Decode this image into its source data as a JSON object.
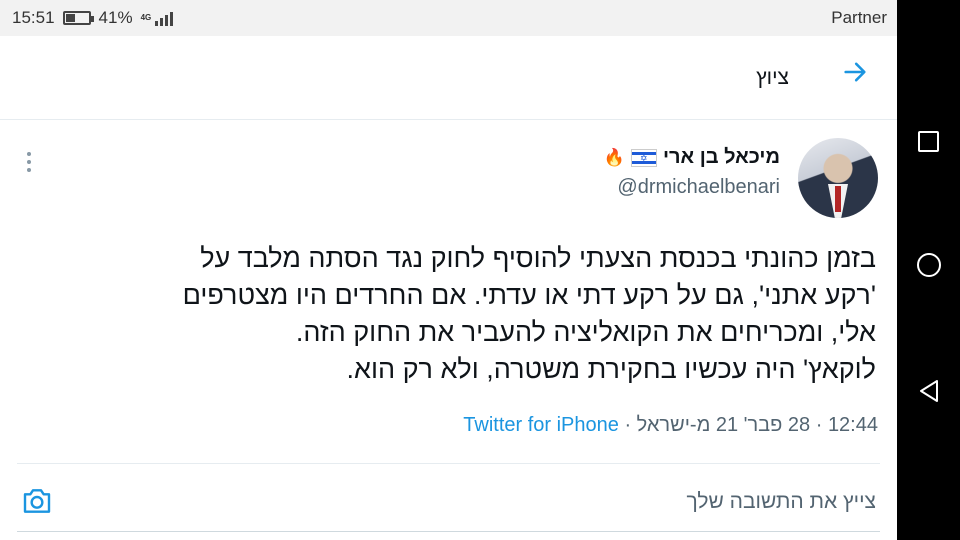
{
  "status_bar": {
    "time": "15:51",
    "battery": "41%",
    "battery_level": 0.41,
    "network": "4G",
    "carrier": "Partner"
  },
  "header": {
    "title": "ציוץ",
    "back_icon": "arrow-right-icon"
  },
  "tweet": {
    "display_name": "מיכאל בן ארי",
    "name_emojis": [
      "israel-flag-icon",
      "fire-icon"
    ],
    "handle": "@drmichaelbenari",
    "text_lines": [
      "בזמן כהונתי בכנסת הצעתי להוסיף לחוק נגד הסתה מלבד על",
      "'רקע אתני', גם על רקע דתי או עדתי. אם החרדים היו מצטרפים",
      "אלי, ומכריחים את הקואליציה להעביר את החוק הזה.",
      "לוקאץ' היה עכשיו בחקירת משטרה, ולא רק הוא."
    ],
    "time": "12:44",
    "date": "28 פבר' 21 מ-ישראל",
    "source": "Twitter for iPhone"
  },
  "reply": {
    "placeholder": "צייץ את התשובה שלך"
  },
  "colors": {
    "accent": "#1b95e0",
    "muted": "#536471",
    "text": "#0f1419"
  }
}
